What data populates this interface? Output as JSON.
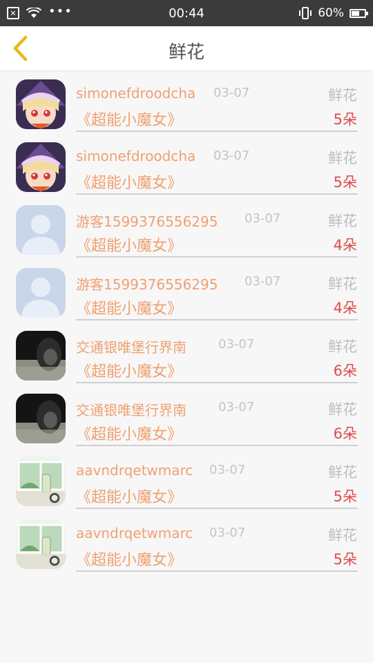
{
  "status_bar": {
    "time": "00:44",
    "battery": "60%",
    "battery_level": 0.6,
    "icons": [
      "close-notification-icon",
      "wifi-icon",
      "more-dots-icon",
      "vibrate-icon",
      "battery-icon"
    ]
  },
  "header": {
    "title": "鲜花",
    "back_icon": "chevron-left-icon"
  },
  "list": [
    {
      "avatar": "anime-girl",
      "name": "simonefdroodcha",
      "date": "03-07",
      "label": "鲜花",
      "book": "《超能小魔女》",
      "count": "5朵"
    },
    {
      "avatar": "anime-girl",
      "name": "simonefdroodcha",
      "date": "03-07",
      "label": "鲜花",
      "book": "《超能小魔女》",
      "count": "5朵"
    },
    {
      "avatar": "default-user",
      "name": "游客1599376556295",
      "date": "03-07",
      "label": "鲜花",
      "book": "《超能小魔女》",
      "count": "4朵"
    },
    {
      "avatar": "default-user",
      "name": "游客1599376556295",
      "date": "03-07",
      "label": "鲜花",
      "book": "《超能小魔女》",
      "count": "4朵"
    },
    {
      "avatar": "dark-photo",
      "name": "交通银唯堡行界南",
      "date": "03-07",
      "label": "鲜花",
      "book": "《超能小魔女》",
      "count": "6朵"
    },
    {
      "avatar": "dark-photo",
      "name": "交通银唯堡行界南",
      "date": "03-07",
      "label": "鲜花",
      "book": "《超能小魔女》",
      "count": "6朵"
    },
    {
      "avatar": "window-photo",
      "name": "aavndrqetwmarc",
      "date": "03-07",
      "label": "鲜花",
      "book": "《超能小魔女》",
      "count": "5朵"
    },
    {
      "avatar": "window-photo",
      "name": "aavndrqetwmarc",
      "date": "03-07",
      "label": "鲜花",
      "book": "《超能小魔女》",
      "count": "5朵"
    }
  ],
  "colors": {
    "accent_orange": "#f0a070",
    "count_red": "#e04a4a",
    "back_arrow": "#e8b820",
    "status_bar_bg": "#3b3b3b"
  }
}
